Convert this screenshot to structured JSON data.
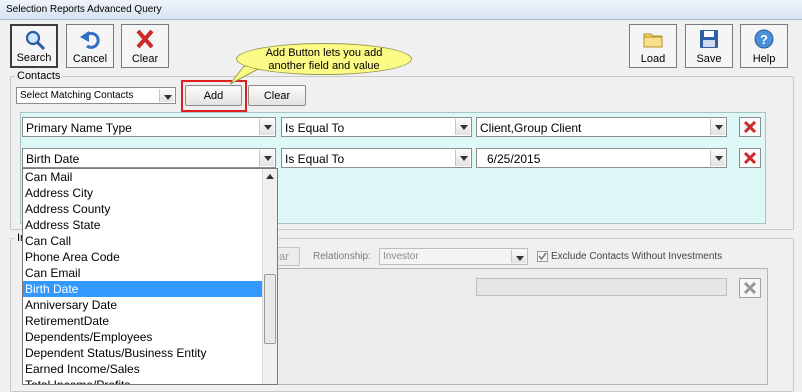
{
  "window": {
    "title": "Selection Reports Advanced Query"
  },
  "toolbar": {
    "search": "Search",
    "cancel": "Cancel",
    "clear": "Clear",
    "load": "Load",
    "save": "Save",
    "help": "Help"
  },
  "contacts": {
    "group_label": "Contacts",
    "match_select": "Select Matching Contacts",
    "add": "Add",
    "clear": "Clear"
  },
  "callout": {
    "line1": "Add Button lets you add",
    "line2": "another field and value"
  },
  "rows": [
    {
      "field": "Primary Name Type",
      "operator": "Is Equal To",
      "value": "Client,Group Client"
    },
    {
      "field": "Birth Date",
      "operator": "Is Equal To",
      "value": "6/25/2015"
    }
  ],
  "dropdown": {
    "items": [
      "Can Mail",
      "Address City",
      "Address County",
      "Address State",
      "Can Call",
      "Phone Area Code",
      "Can Email",
      "Birth Date",
      "Anniversary Date",
      "RetirementDate",
      "Dependents/Employees",
      "Dependent Status/Business Entity",
      "Earned Income/Sales",
      "Total Income/Profits"
    ],
    "selected": "Birth Date"
  },
  "second_group": {
    "label_fragment": "In",
    "clear_fragment": "ear",
    "relationship_label": "Relationship:",
    "relationship_value": "Investor",
    "exclude_label": "Exclude Contacts Without Investments",
    "exclude_checked": true
  },
  "colors": {
    "highlight": "#3399ff",
    "criteria_bg": "#ddf8f6",
    "callout_bg": "#fbfb86",
    "annotation_box": "#e02020",
    "delete_x": "#cc2a2a"
  },
  "icons": [
    "search-icon",
    "undo-icon",
    "clear-icon",
    "folder-icon",
    "floppy-icon",
    "help-icon",
    "delete-x-icon"
  ]
}
